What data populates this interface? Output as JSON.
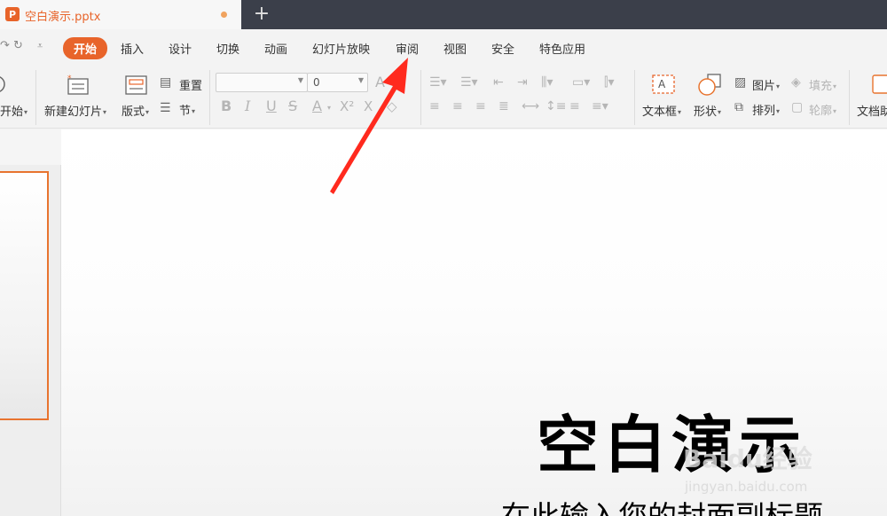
{
  "colors": {
    "accent": "#e8642a",
    "titlebar": "#3b3f4a",
    "arrow": "#ff2a1e"
  },
  "titlebar": {
    "tab_title": "空白演示.pptx",
    "app_icon": "P",
    "new_tab": "+"
  },
  "menu": {
    "items": [
      "开始",
      "插入",
      "设计",
      "切换",
      "动画",
      "幻灯片放映",
      "审阅",
      "视图",
      "安全",
      "特色应用"
    ],
    "active": "开始"
  },
  "ribbon": {
    "start_label": "开始",
    "new_slide": "新建幻灯片",
    "layout": "版式",
    "reset": "重置",
    "section": "节",
    "font_name": "",
    "font_size": "0",
    "bold": "B",
    "italic": "I",
    "underline": "U",
    "strike": "S",
    "font_color": "A",
    "superscript": "X²",
    "textbox": "文本框",
    "shape": "形状",
    "picture": "图片",
    "arrange": "排列",
    "fill": "填充",
    "outline": "轮廓",
    "doc": "文档助"
  },
  "slide": {
    "title": "空白演示",
    "subtitle": "在此输入您的封面副标题"
  },
  "watermark": {
    "logo": "Baidu经验",
    "url": "jingyan.baidu.com"
  }
}
